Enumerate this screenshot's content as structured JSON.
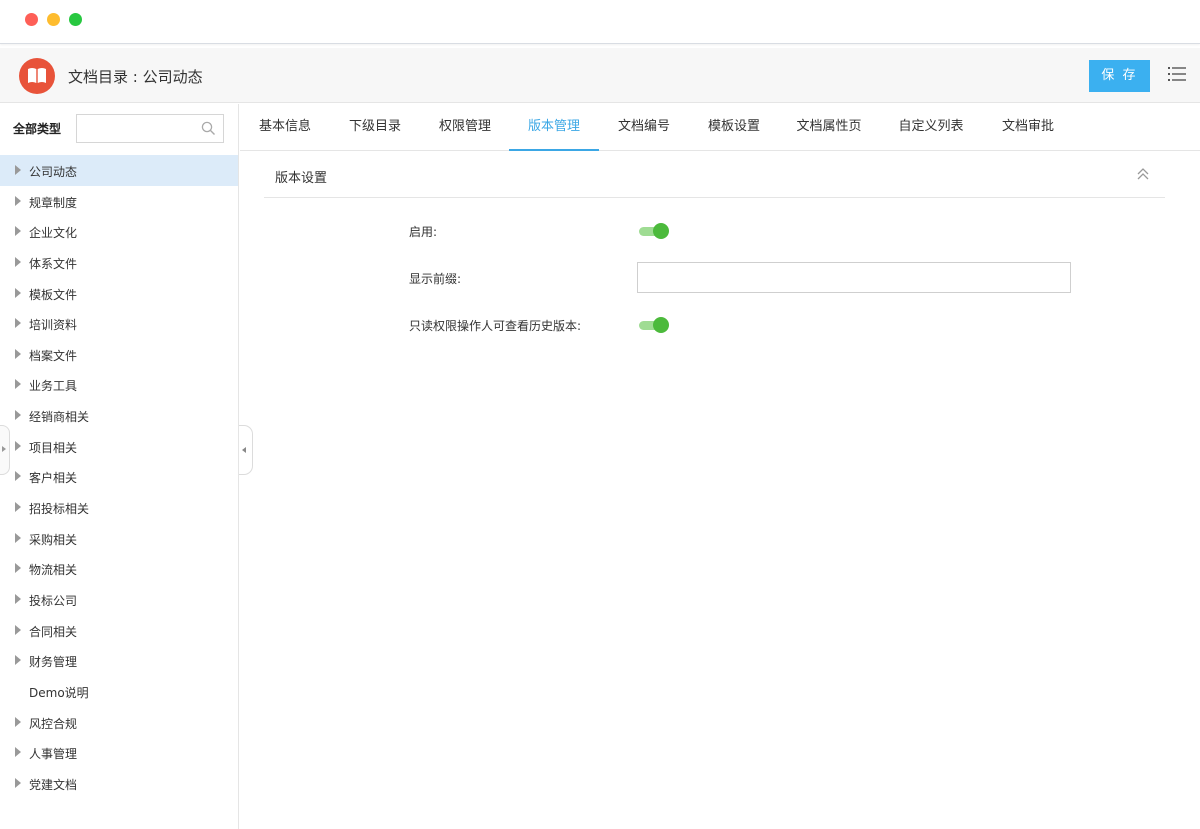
{
  "header": {
    "title": "文档目录 : 公司动态",
    "save_label": "保 存"
  },
  "sidebar": {
    "all_types_label": "全部类型",
    "search_placeholder": "",
    "items": [
      {
        "label": "公司动态",
        "has_children": true,
        "active": true
      },
      {
        "label": "规章制度",
        "has_children": true
      },
      {
        "label": "企业文化",
        "has_children": true
      },
      {
        "label": "体系文件",
        "has_children": true
      },
      {
        "label": "模板文件",
        "has_children": true
      },
      {
        "label": "培训资料",
        "has_children": true
      },
      {
        "label": "档案文件",
        "has_children": true
      },
      {
        "label": "业务工具",
        "has_children": true
      },
      {
        "label": "经销商相关",
        "has_children": true
      },
      {
        "label": "项目相关",
        "has_children": true
      },
      {
        "label": "客户相关",
        "has_children": true
      },
      {
        "label": "招投标相关",
        "has_children": true
      },
      {
        "label": "采购相关",
        "has_children": true
      },
      {
        "label": "物流相关",
        "has_children": true
      },
      {
        "label": "投标公司",
        "has_children": true
      },
      {
        "label": "合同相关",
        "has_children": true
      },
      {
        "label": "财务管理",
        "has_children": true
      },
      {
        "label": "Demo说明",
        "has_children": false
      },
      {
        "label": "风控合规",
        "has_children": true
      },
      {
        "label": "人事管理",
        "has_children": true
      },
      {
        "label": "党建文档",
        "has_children": true
      }
    ]
  },
  "tabs": [
    {
      "label": "基本信息"
    },
    {
      "label": "下级目录"
    },
    {
      "label": "权限管理"
    },
    {
      "label": "版本管理",
      "active": true
    },
    {
      "label": "文档编号"
    },
    {
      "label": "模板设置"
    },
    {
      "label": "文档属性页"
    },
    {
      "label": "自定义列表"
    },
    {
      "label": "文档审批"
    }
  ],
  "section": {
    "title": "版本设置"
  },
  "form": {
    "enable_label": "启用:",
    "enable_value": true,
    "prefix_label": "显示前缀:",
    "prefix_value": "",
    "readonly_history_label": "只读权限操作人可查看历史版本:",
    "readonly_history_value": true
  },
  "colors": {
    "accent": "#3ba7e5",
    "save_button": "#3bb0f0",
    "toggle_on": "#4cba3c",
    "logo": "#e8533a",
    "active_row": "#dcebf9"
  },
  "icons": {
    "logo": "open-book-icon",
    "menu": "list-menu-icon",
    "search": "search-icon",
    "collapse_section": "double-chevron-up-icon"
  }
}
